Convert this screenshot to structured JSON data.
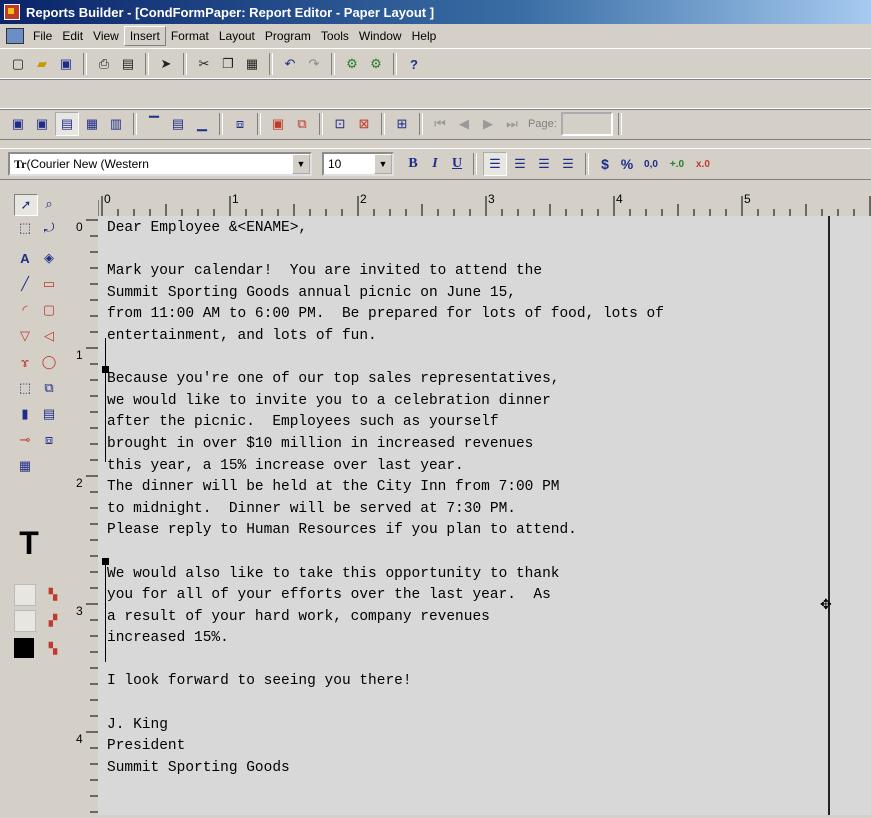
{
  "window": {
    "title": "Reports Builder - [CondFormPaper: Report Editor - Paper Layout ]"
  },
  "menu": {
    "items": [
      "File",
      "Edit",
      "View",
      "Insert",
      "Format",
      "Layout",
      "Program",
      "Tools",
      "Window",
      "Help"
    ]
  },
  "toolbar_nav": {
    "page_label": "Page:"
  },
  "font_toolbar": {
    "font": "(Courier New (Western",
    "size": "10",
    "bold": "B",
    "italic": "I",
    "underline": "U",
    "currency": "$",
    "percent": "%",
    "commas": "0,0",
    "add_decimal": "+.0",
    "remove_decimal": "x.0"
  },
  "ruler": {
    "h_labels": [
      "0",
      "1",
      "2",
      "3",
      "4",
      "5"
    ],
    "v_labels": [
      "0",
      "1",
      "2",
      "3",
      "4"
    ]
  },
  "letter": {
    "lines": [
      "Dear Employee &<ENAME>,",
      "",
      "Mark your calendar!  You are invited to attend the",
      "Summit Sporting Goods annual picnic on June 15,",
      "from 11:00 AM to 6:00 PM.  Be prepared for lots of food, lots of",
      "entertainment, and lots of fun.",
      "",
      "Because you're one of our top sales representatives,",
      "we would like to invite you to a celebration dinner",
      "after the picnic.  Employees such as yourself",
      "brought in over $10 million in increased revenues",
      "this year, a 15% increase over last year.",
      "The dinner will be held at the City Inn from 7:00 PM",
      "to midnight.  Dinner will be served at 7:30 PM.",
      "Please reply to Human Resources if you plan to attend.",
      "",
      "We would also like to take this opportunity to thank",
      "you for all of your efforts over the last year.  As",
      "a result of your hard work, company revenues",
      "increased 15%.",
      "",
      "I look forward to seeing you there!",
      "",
      "J. King",
      "President",
      "Summit Sporting Goods"
    ]
  },
  "colors": {
    "title_bar": "#0a246a",
    "chrome": "#d4d0c8",
    "accent_blue": "#1f2d8a"
  }
}
